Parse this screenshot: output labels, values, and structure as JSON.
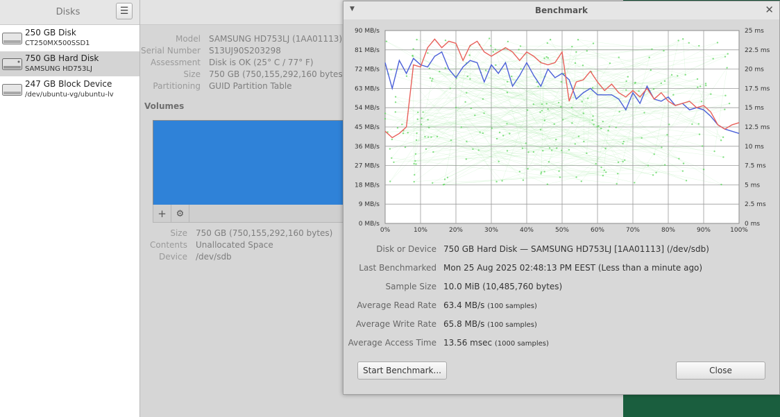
{
  "sidebar": {
    "title": "Disks",
    "disks": [
      {
        "name": "250 GB Disk",
        "sub": "CT250MX500SSD1",
        "icon": "ssd-disk-icon"
      },
      {
        "name": "750 GB Hard Disk",
        "sub": "SAMSUNG HD753LJ",
        "icon": "hard-disk-icon",
        "selected": true
      },
      {
        "name": "247 GB Block Device",
        "sub": "/dev/ubuntu-vg/ubuntu-lv",
        "icon": "block-device-icon"
      }
    ]
  },
  "drive": {
    "model_label": "Model",
    "model": "SAMSUNG HD753LJ (1AA01113)",
    "serial_label": "Serial Number",
    "serial": "S13UJ90S203298",
    "assessment_label": "Assessment",
    "assessment": "Disk is OK (25° C / 77° F)",
    "size_label": "Size",
    "size": "750 GB (750,155,292,160 bytes)",
    "partitioning_label": "Partitioning",
    "partitioning": "GUID Partition Table"
  },
  "volumes": {
    "heading": "Volumes",
    "add_icon": "plus-icon",
    "settings_icon": "gears-icon",
    "size_label": "Size",
    "size": "750 GB (750,155,292,160 bytes)",
    "contents_label": "Contents",
    "contents": "Unallocated Space",
    "device_label": "Device",
    "device": "/dev/sdb"
  },
  "benchmark": {
    "title": "Benchmark",
    "info": [
      {
        "label": "Disk or Device",
        "value": "750 GB Hard Disk — SAMSUNG HD753LJ [1AA01113] (/dev/sdb)",
        "note": ""
      },
      {
        "label": "Last Benchmarked",
        "value": "Mon 25 Aug 2025 02:48:13 PM EEST (Less than a minute ago)",
        "note": ""
      },
      {
        "label": "Sample Size",
        "value": "10.0 MiB (10,485,760 bytes)",
        "note": ""
      },
      {
        "label": "Average Read Rate",
        "value": "63.4 MB/s",
        "note": "(100 samples)"
      },
      {
        "label": "Average Write Rate",
        "value": "65.8 MB/s",
        "note": "(100 samples)"
      },
      {
        "label": "Average Access Time",
        "value": "13.56 msec",
        "note": "(1000 samples)"
      }
    ],
    "start_button": "Start Benchmark...",
    "close_button": "Close"
  },
  "chart_data": {
    "type": "line",
    "x_unit": "percent of disk",
    "xlim": [
      0,
      100
    ],
    "x_ticks": [
      "0%",
      "10%",
      "20%",
      "30%",
      "40%",
      "50%",
      "60%",
      "70%",
      "80%",
      "90%",
      "100%"
    ],
    "ylim_left": [
      0,
      90
    ],
    "y_ticks_left": [
      "0 MB/s",
      "9 MB/s",
      "18 MB/s",
      "27 MB/s",
      "36 MB/s",
      "45 MB/s",
      "54 MB/s",
      "63 MB/s",
      "72 MB/s",
      "81 MB/s",
      "90 MB/s"
    ],
    "ylim_right": [
      0,
      25
    ],
    "y_ticks_right": [
      "0 ms",
      "2.5 ms",
      "5 ms",
      "7.5 ms",
      "10 ms",
      "12.5 ms",
      "15 ms",
      "17.5 ms",
      "20 ms",
      "22.5 ms",
      "25 ms"
    ],
    "grid": true,
    "legend": "none",
    "colors": {
      "read": "#4a5fd8",
      "write": "#e8605a",
      "access": "#5cd65c"
    },
    "series": [
      {
        "key": "read",
        "x": [
          0,
          2,
          4,
          6,
          8,
          10,
          12,
          14,
          16,
          18,
          20,
          22,
          24,
          26,
          28,
          30,
          32,
          34,
          36,
          38,
          40,
          42,
          44,
          46,
          48,
          50,
          52,
          54,
          56,
          58,
          60,
          62,
          64,
          66,
          68,
          70,
          72,
          74,
          76,
          78,
          80,
          82,
          84,
          86,
          88,
          90,
          92,
          94,
          96,
          98,
          100
        ],
        "values": [
          75,
          63,
          76,
          70,
          77,
          74,
          73,
          78,
          80,
          72,
          68,
          73,
          76,
          75,
          66,
          74,
          70,
          75,
          64,
          69,
          75,
          69,
          64,
          72,
          68,
          70,
          67,
          58,
          61,
          63,
          60,
          60,
          60,
          58,
          53,
          61,
          56,
          64,
          58,
          57,
          59,
          55,
          56,
          53,
          54,
          53,
          50,
          46,
          44,
          43,
          42
        ]
      },
      {
        "key": "write",
        "x": [
          0,
          2,
          4,
          6,
          8,
          10,
          12,
          14,
          16,
          18,
          20,
          22,
          24,
          26,
          28,
          30,
          32,
          34,
          36,
          38,
          40,
          42,
          44,
          46,
          48,
          50,
          52,
          54,
          56,
          58,
          60,
          62,
          64,
          66,
          68,
          70,
          72,
          74,
          76,
          78,
          80,
          82,
          84,
          86,
          88,
          90,
          92,
          94,
          96,
          98,
          100
        ],
        "values": [
          43,
          40,
          42,
          45,
          74,
          73,
          82,
          86,
          82,
          85,
          84,
          76,
          83,
          85,
          80,
          78,
          80,
          82,
          80,
          76,
          80,
          78,
          75,
          74,
          75,
          80,
          57,
          66,
          67,
          71,
          66,
          62,
          65,
          61,
          59,
          62,
          59,
          63,
          58,
          61,
          57,
          55,
          56,
          57,
          54,
          55,
          52,
          46,
          44,
          46,
          47
        ]
      }
    ]
  }
}
